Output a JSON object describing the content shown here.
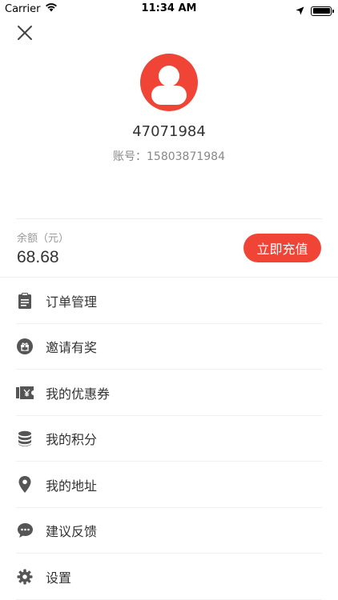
{
  "status_bar": {
    "carrier": "Carrier",
    "time": "11:34 AM"
  },
  "profile": {
    "username": "47071984",
    "account": "账号：15803871984"
  },
  "balance": {
    "label": "余额（元）",
    "value": "68.68",
    "recharge_label": "立即充值"
  },
  "menu": {
    "items": [
      {
        "label": "订单管理",
        "icon": "clipboard-icon"
      },
      {
        "label": "邀请有奖",
        "icon": "gift-icon"
      },
      {
        "label": "我的优惠券",
        "icon": "coupon-icon"
      },
      {
        "label": "我的积分",
        "icon": "coins-icon"
      },
      {
        "label": "我的地址",
        "icon": "location-pin-icon"
      },
      {
        "label": "建议反馈",
        "icon": "chat-bubble-icon"
      },
      {
        "label": "设置",
        "icon": "gear-icon"
      }
    ]
  },
  "colors": {
    "accent": "#f04437",
    "icon": "#555555",
    "text": "#333333",
    "muted": "#888888"
  }
}
